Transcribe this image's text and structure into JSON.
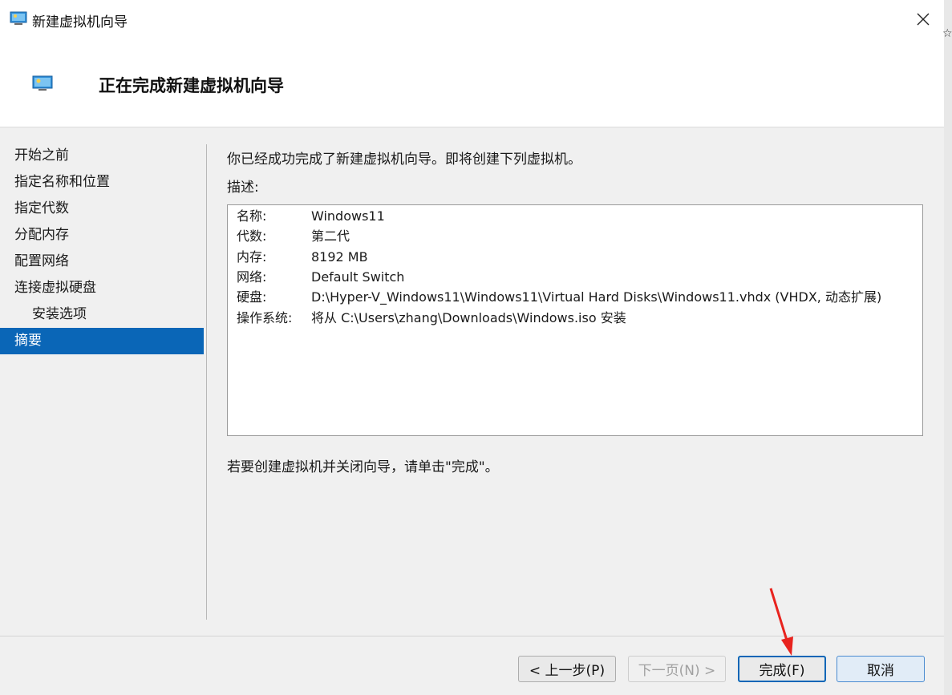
{
  "window": {
    "title": "新建虚拟机向导",
    "header_title": "正在完成新建虚拟机向导"
  },
  "nav": {
    "items": [
      {
        "label": "开始之前"
      },
      {
        "label": "指定名称和位置"
      },
      {
        "label": "指定代数"
      },
      {
        "label": "分配内存"
      },
      {
        "label": "配置网络"
      },
      {
        "label": "连接虚拟硬盘"
      },
      {
        "label": "安装选项"
      },
      {
        "label": "摘要"
      }
    ],
    "active": "摘要"
  },
  "content": {
    "intro": "你已经成功完成了新建虚拟机向导。即将创建下列虚拟机。",
    "desc_label": "描述:",
    "rows": [
      {
        "k": "名称:",
        "v": "Windows11"
      },
      {
        "k": "代数:",
        "v": "第二代"
      },
      {
        "k": "内存:",
        "v": "8192 MB"
      },
      {
        "k": "网络:",
        "v": "Default Switch"
      },
      {
        "k": "硬盘:",
        "v": "D:\\Hyper-V_Windows11\\Windows11\\Virtual Hard Disks\\Windows11.vhdx (VHDX, 动态扩展)"
      },
      {
        "k": "操作系统:",
        "v": "将从 C:\\Users\\zhang\\Downloads\\Windows.iso 安装"
      }
    ],
    "outro": "若要创建虚拟机并关闭向导，请单击\"完成\"。"
  },
  "buttons": {
    "back": "< 上一步(P)",
    "next": "下一页(N) >",
    "finish": "完成(F)",
    "cancel": "取消"
  },
  "icons": {
    "window": "hyperv-monitor-icon",
    "close": "close-icon",
    "annotation": "red-arrow-icon"
  },
  "colors": {
    "accent": "#0a66b7",
    "arrow": "#e8231e"
  }
}
